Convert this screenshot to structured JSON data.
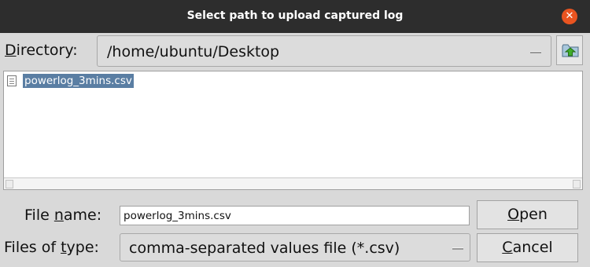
{
  "dialog": {
    "title": "Select path to upload captured log"
  },
  "directory": {
    "label_pre": "",
    "label_mnemonic": "D",
    "label_post": "irectory:",
    "value": "/home/ubuntu/Desktop"
  },
  "files": [
    {
      "name": "powerlog_3mins.csv",
      "icon": "document-icon"
    }
  ],
  "filename": {
    "label_pre": "File ",
    "label_mnemonic": "n",
    "label_post": "ame:",
    "value": "powerlog_3mins.csv"
  },
  "filetype": {
    "label_pre": "Files of ",
    "label_mnemonic": "t",
    "label_post": "ype:",
    "value": "comma-separated values file (*.csv)"
  },
  "buttons": {
    "open": {
      "mnemonic": "O",
      "rest": "pen"
    },
    "cancel": {
      "mnemonic": "C",
      "rest": "ancel"
    }
  },
  "colors": {
    "titlebar": "#2d2d2d",
    "close": "#e95420",
    "selection": "#5a7ea3"
  }
}
